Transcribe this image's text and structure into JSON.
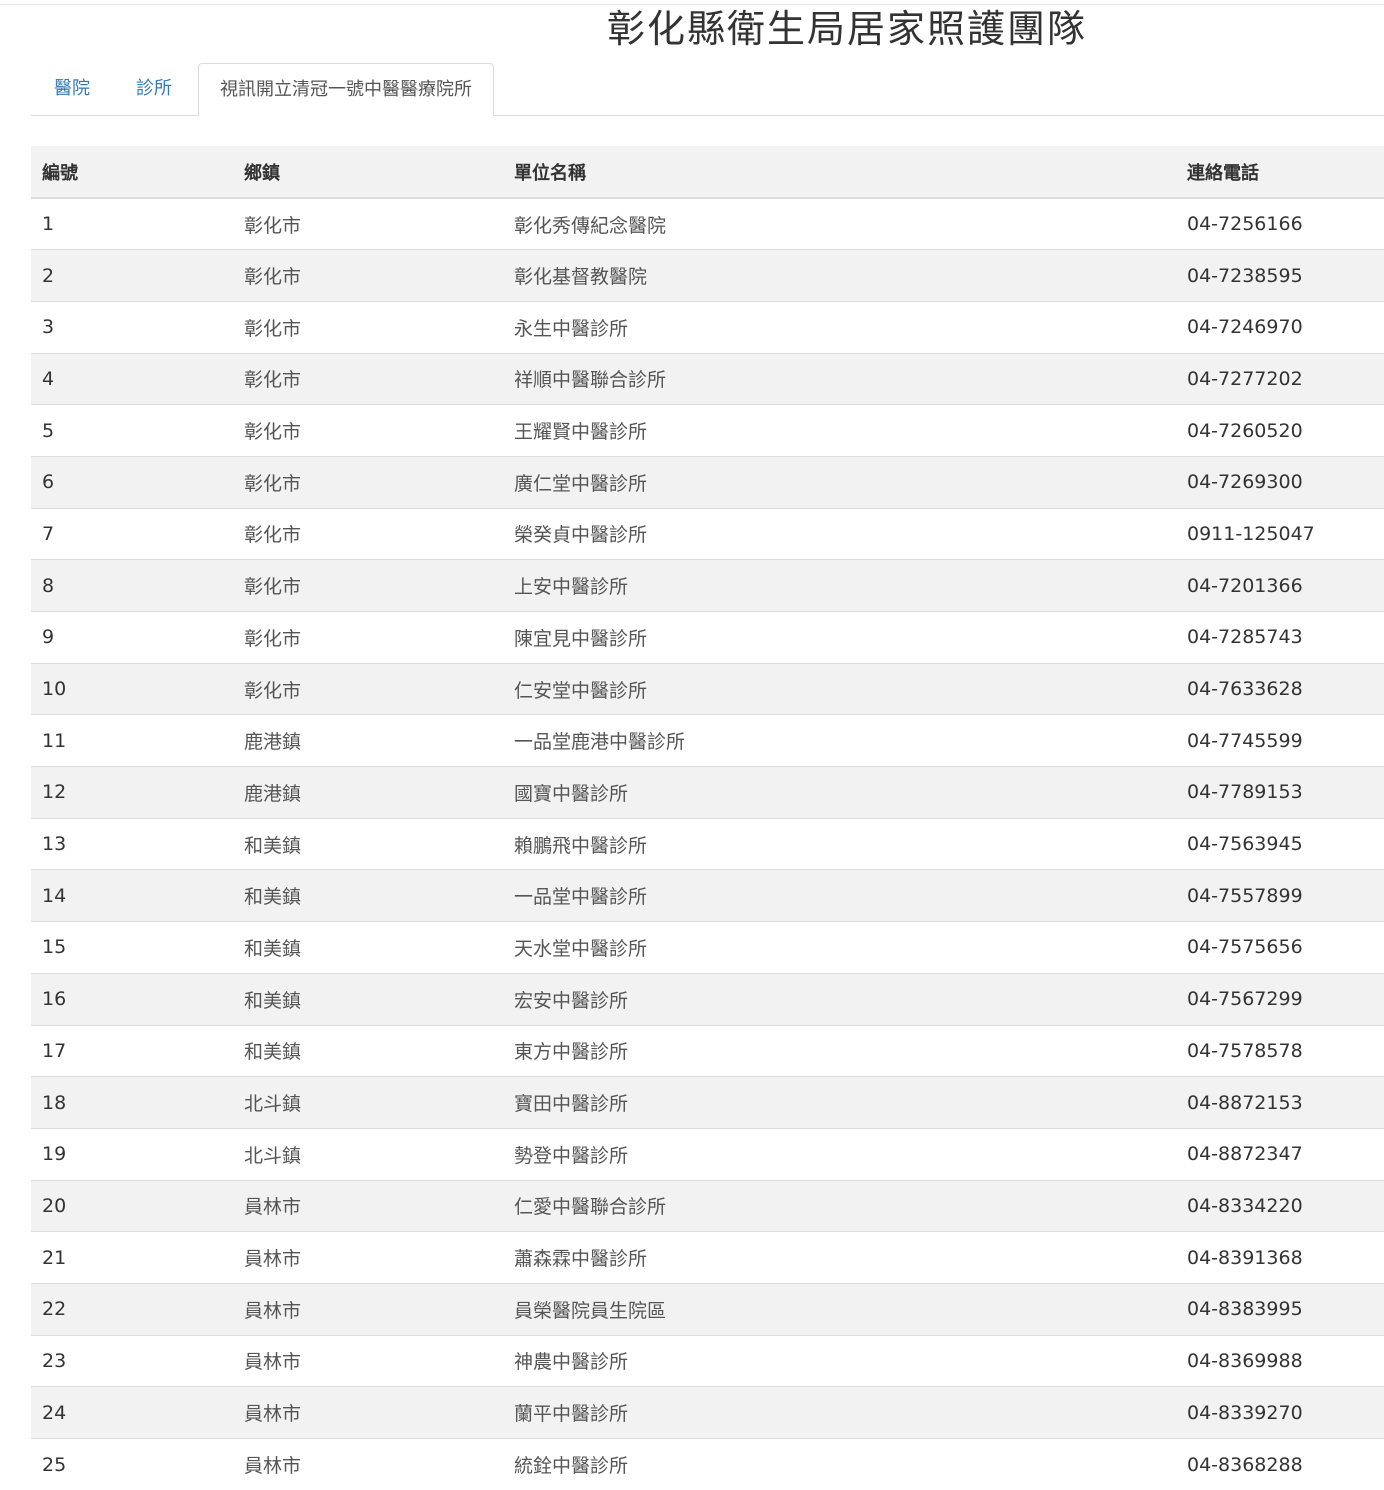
{
  "page": {
    "title": "彰化縣衛生局居家照護團隊"
  },
  "tabs": [
    {
      "label": "醫院",
      "active": false
    },
    {
      "label": "診所",
      "active": false
    },
    {
      "label": "視訊開立清冠一號中醫醫療院所",
      "active": true
    }
  ],
  "table": {
    "headers": [
      "編號",
      "鄉鎮",
      "單位名稱",
      "連絡電話"
    ],
    "rows": [
      [
        "1",
        "彰化市",
        "彰化秀傳紀念醫院",
        "04-7256166"
      ],
      [
        "2",
        "彰化市",
        "彰化基督教醫院",
        "04-7238595"
      ],
      [
        "3",
        "彰化市",
        "永生中醫診所",
        "04-7246970"
      ],
      [
        "4",
        "彰化市",
        "祥順中醫聯合診所",
        "04-7277202"
      ],
      [
        "5",
        "彰化市",
        "王耀賢中醫診所",
        "04-7260520"
      ],
      [
        "6",
        "彰化市",
        "廣仁堂中醫診所",
        "04-7269300"
      ],
      [
        "7",
        "彰化市",
        "榮癸貞中醫診所",
        "0911-125047"
      ],
      [
        "8",
        "彰化市",
        "上安中醫診所",
        "04-7201366"
      ],
      [
        "9",
        "彰化市",
        "陳宜見中醫診所",
        "04-7285743"
      ],
      [
        "10",
        "彰化市",
        "仁安堂中醫診所",
        "04-7633628"
      ],
      [
        "11",
        "鹿港鎮",
        "一品堂鹿港中醫診所",
        "04-7745599"
      ],
      [
        "12",
        "鹿港鎮",
        "國寶中醫診所",
        "04-7789153"
      ],
      [
        "13",
        "和美鎮",
        "賴鵬飛中醫診所",
        "04-7563945"
      ],
      [
        "14",
        "和美鎮",
        "一品堂中醫診所",
        "04-7557899"
      ],
      [
        "15",
        "和美鎮",
        "天水堂中醫診所",
        "04-7575656"
      ],
      [
        "16",
        "和美鎮",
        "宏安中醫診所",
        "04-7567299"
      ],
      [
        "17",
        "和美鎮",
        "東方中醫診所",
        "04-7578578"
      ],
      [
        "18",
        "北斗鎮",
        "寶田中醫診所",
        "04-8872153"
      ],
      [
        "19",
        "北斗鎮",
        "勢登中醫診所",
        "04-8872347"
      ],
      [
        "20",
        "員林市",
        "仁愛中醫聯合診所",
        "04-8334220"
      ],
      [
        "21",
        "員林市",
        "蕭森霖中醫診所",
        "04-8391368"
      ],
      [
        "22",
        "員林市",
        "員榮醫院員生院區",
        "04-8383995"
      ],
      [
        "23",
        "員林市",
        "神農中醫診所",
        "04-8369988"
      ],
      [
        "24",
        "員林市",
        "蘭平中醫診所",
        "04-8339270"
      ],
      [
        "25",
        "員林市",
        "統銓中醫診所",
        "04-8368288"
      ]
    ]
  },
  "colors": {
    "link": "#337ab7",
    "stripe": "#f2f2f2",
    "border": "#dddddd"
  }
}
